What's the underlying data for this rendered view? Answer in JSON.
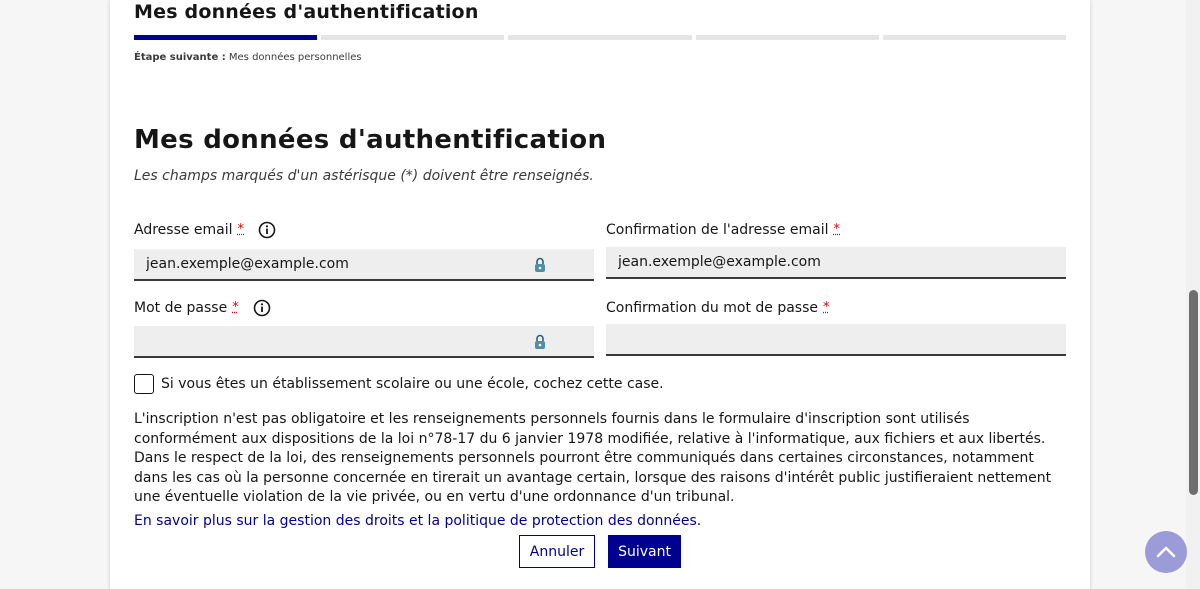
{
  "stepper": {
    "title": "Mes données d'authentification",
    "steps_total": 5,
    "current_step": 1,
    "next_label": "Étape suivante :",
    "next_value": "Mes données personnelles"
  },
  "form": {
    "heading": "Mes données d'authentification",
    "required_hint": "Les champs marqués d'un astérisque (*) doivent être renseignés.",
    "required_marker": "*",
    "email": {
      "label": "Adresse email",
      "value": "jean.exemple@example.com"
    },
    "email_confirm": {
      "label": "Confirmation de l'adresse email",
      "value": "jean.exemple@example.com"
    },
    "password": {
      "label": "Mot de passe",
      "value": ""
    },
    "password_confirm": {
      "label": "Confirmation du mot de passe",
      "value": ""
    },
    "school_checkbox": {
      "label": "Si vous êtes un établissement scolaire ou une école, cochez cette case.",
      "checked": false
    },
    "legal_text": "L'inscription n'est pas obligatoire et les renseignements personnels fournis dans le formulaire d'inscription sont utilisés conformément aux dispositions de la loi n°78-17 du 6 janvier 1978 modifiée, relative à l'informatique, aux fichiers et aux libertés. Dans le respect de la loi, des renseignements personnels pourront être communiqués dans certaines circonstances, notamment dans les cas où la personne concernée en tirerait un avantage certain, lorsque des raisons d'intérêt public justifieraient nettement une éventuelle violation de la vie privée, ou en vertu d'une ordonnance d'un tribunal.",
    "legal_link": "En savoir plus sur la gestion des droits et la politique de protection des données.",
    "cancel_label": "Annuler",
    "next_button_label": "Suivant"
  },
  "icons": {
    "info": "info-icon",
    "password_manager": "password-manager-icon",
    "back_to_top": "chevron-up-icon"
  },
  "colors": {
    "primary": "#000091",
    "required": "#ce0500",
    "back_to_top": "#9b9bd8"
  }
}
